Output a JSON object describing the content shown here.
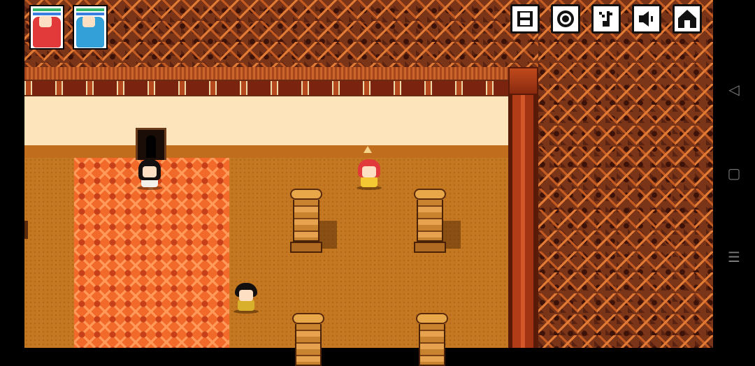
{
  "game": {
    "scene": "temple-interior"
  },
  "party": [
    {
      "name": "red-haired-heroine",
      "hair_color": "#e23a3a",
      "outfit_color": "#f4c832"
    },
    {
      "name": "blue-haired-companion",
      "hair_color": "#33a0d8",
      "outfit_color": "#6ec8f0"
    }
  ],
  "toolbar": [
    {
      "icon": "save-icon"
    },
    {
      "icon": "settings-icon"
    },
    {
      "icon": "music-icon"
    },
    {
      "icon": "sound-icon"
    },
    {
      "icon": "home-icon"
    }
  ],
  "characters": [
    {
      "name": "player-red-hair",
      "hair_color": "#e23a3a",
      "outfit_color": "#f4c832"
    },
    {
      "name": "npc-black-hair-woman",
      "hair_color": "#141010",
      "outfit_color": "#f4f0ea"
    },
    {
      "name": "npc-black-hair-man",
      "hair_color": "#141010",
      "outfit_color": "#d8b02c"
    }
  ],
  "system_nav": [
    {
      "icon": "back-icon",
      "glyph": "◁"
    },
    {
      "icon": "home-square-icon",
      "glyph": "▢"
    },
    {
      "icon": "recents-icon",
      "glyph": "☰"
    }
  ],
  "colors": {
    "wall": "#fde4ba",
    "floor": "#c47821",
    "carpet": "#f26a2a",
    "pillar": "#b23c18",
    "rock": "#7a3418"
  }
}
